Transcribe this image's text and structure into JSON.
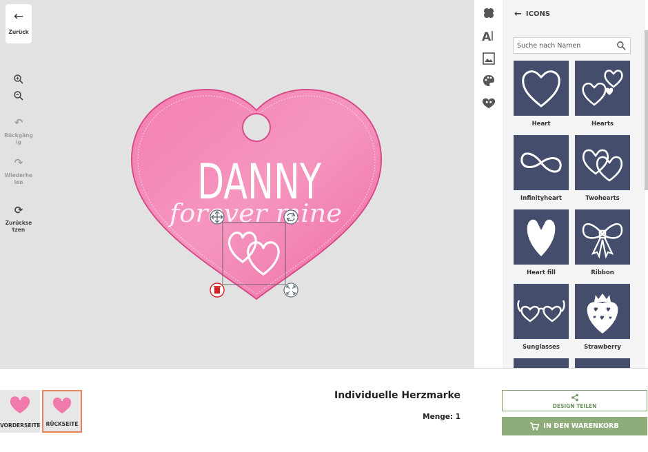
{
  "toolbar": {
    "back_label": "Zurück",
    "undo_label": "Rückgäng ig",
    "redo_label": "Wiederhe len",
    "reset_label": "Zurückse tzen"
  },
  "design": {
    "name_text": "DANNY",
    "script_text": "forever mine",
    "tag_color": "#ef76a6"
  },
  "panel": {
    "title": "ICONS",
    "search_placeholder": "Suche nach Namen",
    "items": [
      {
        "label": "Heart",
        "icon": "heart-outline-icon"
      },
      {
        "label": "Hearts",
        "icon": "hearts-icon"
      },
      {
        "label": "Infinityheart",
        "icon": "infinity-heart-icon"
      },
      {
        "label": "Twohearts",
        "icon": "two-hearts-icon"
      },
      {
        "label": "Heart fill",
        "icon": "heart-fill-icon"
      },
      {
        "label": "Ribbon",
        "icon": "ribbon-icon"
      },
      {
        "label": "Sunglasses",
        "icon": "sunglasses-icon"
      },
      {
        "label": "Strawberry",
        "icon": "strawberry-icon"
      }
    ],
    "tile_color": "#444e6c"
  },
  "footer": {
    "front_label": "VORDERSEITE",
    "back_label": "RÜCKSEITE",
    "product_title": "Individuelle Herzmarke",
    "quantity": "Menge: 1",
    "share_label": "DESIGN TEILEN",
    "cart_label": "IN DEN WARENKORB"
  },
  "colors": {
    "accent_green": "#8fad7a",
    "selected_border": "#e8825a",
    "delete_red": "#d62020"
  }
}
